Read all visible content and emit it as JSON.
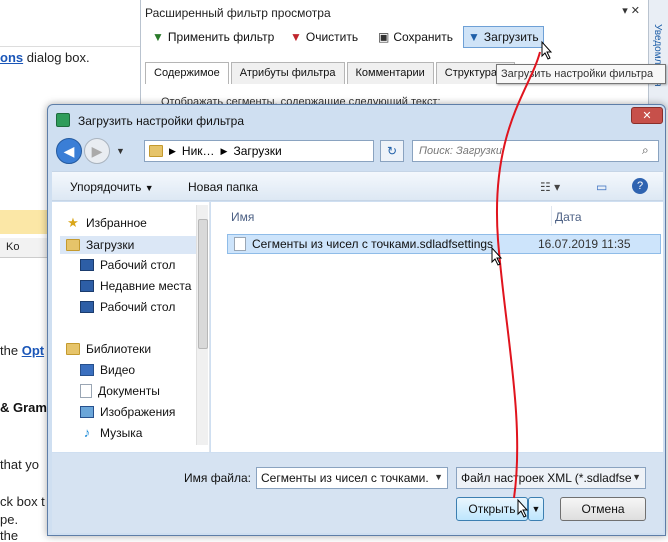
{
  "background_doc": {
    "line1_link": "ons",
    "line1_rest": "dialog box.",
    "line2_prefix": "the",
    "line2_link": "Opt",
    "line3": "& Gram",
    "line4": "that yo",
    "line5": "ck box t",
    "line6": "pe.",
    "line7": "the",
    "toolbar_fragment": "Ko"
  },
  "filter_panel": {
    "title": "Расширенный фильтр просмотра",
    "close_glyph": "▾ ✕",
    "toolbar": [
      {
        "label": "Применить фильтр",
        "icon": "funnel-check-icon"
      },
      {
        "label": "Очистить",
        "icon": "funnel-clear-icon"
      },
      {
        "label": "Сохранить",
        "icon": "save-icon"
      },
      {
        "label": "Загрузить",
        "icon": "funnel-load-icon"
      }
    ],
    "tabs": [
      "Содержимое",
      "Атрибуты фильтра",
      "Комментарии",
      "Структура д"
    ],
    "content_line": "Отображать сегменты, содержащие следующий текст:",
    "right_strip_label": "Уведомления"
  },
  "tooltip": "Загрузить настройки фильтра",
  "dialog": {
    "title": "Загрузить настройки фильтра",
    "close_glyph": "✕",
    "breadcrumb": [
      "Ник…",
      "Загрузки"
    ],
    "search_placeholder": "Поиск: Загрузки",
    "commands": {
      "organize": "Упорядочить",
      "new_folder": "Новая папка"
    },
    "nav": {
      "favorites_header": "Избранное",
      "favorites": [
        "Загрузки",
        "Рабочий стол",
        "Недавние места",
        "Рабочий стол"
      ],
      "libraries_header": "Библиотеки",
      "libraries": [
        "Видео",
        "Документы",
        "Изображения",
        "Музыка"
      ]
    },
    "columns": {
      "name": "Имя",
      "date": "Дата"
    },
    "files": [
      {
        "name": "Сегменты из чисел с точками.sdladfsettings",
        "date": "16.07.2019 11:35"
      }
    ],
    "filename_label": "Имя файла:",
    "filename_value": "Сегменты из чисел с точками.",
    "filetype_value": "Файл настроек XML (*.sdladfse",
    "open_label": "Открыть",
    "cancel_label": "Отмена"
  },
  "colors": {
    "accent_red": "#e0141e",
    "selection": "#cde4fb",
    "dialog_frame": "#cfdff1"
  }
}
